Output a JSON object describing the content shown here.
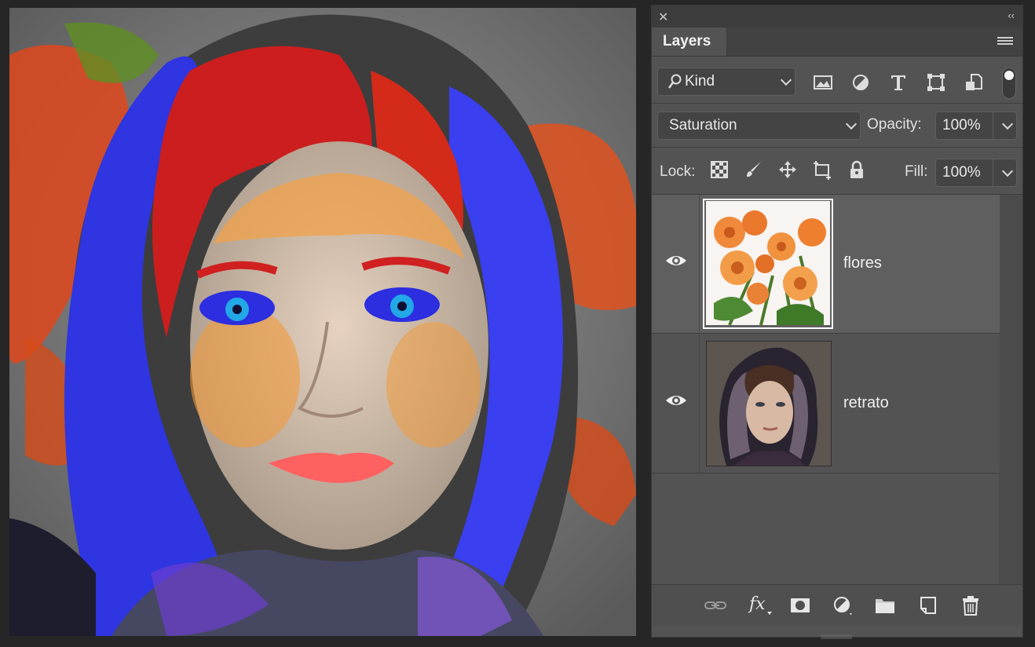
{
  "panel": {
    "tab_label": "Layers",
    "close_glyph": "✕",
    "collapse_glyph": "‹‹"
  },
  "filter": {
    "kind_label": "Kind",
    "icons": [
      "image-filter-icon",
      "adjustment-filter-icon",
      "type-filter-icon",
      "shape-filter-icon",
      "smart-object-filter-icon",
      "filter-toggle"
    ]
  },
  "blend": {
    "mode": "Saturation",
    "opacity_label": "Opacity:",
    "opacity_value": "100%"
  },
  "lock": {
    "label": "Lock:",
    "fill_label": "Fill:",
    "fill_value": "100%"
  },
  "layers": [
    {
      "name": "flores",
      "visible": true,
      "selected": true
    },
    {
      "name": "retrato",
      "visible": true,
      "selected": false
    }
  ],
  "bottom_icons": [
    "link-layers-icon",
    "fx-icon",
    "layer-mask-icon",
    "adjustment-layer-icon",
    "new-group-icon",
    "new-layer-icon",
    "delete-layer-icon"
  ],
  "bottom": {
    "fx_label": "fx"
  },
  "colors": {
    "panel_bg": "#535353",
    "selected_row": "#5f5f5f",
    "app_bg": "#262626"
  }
}
